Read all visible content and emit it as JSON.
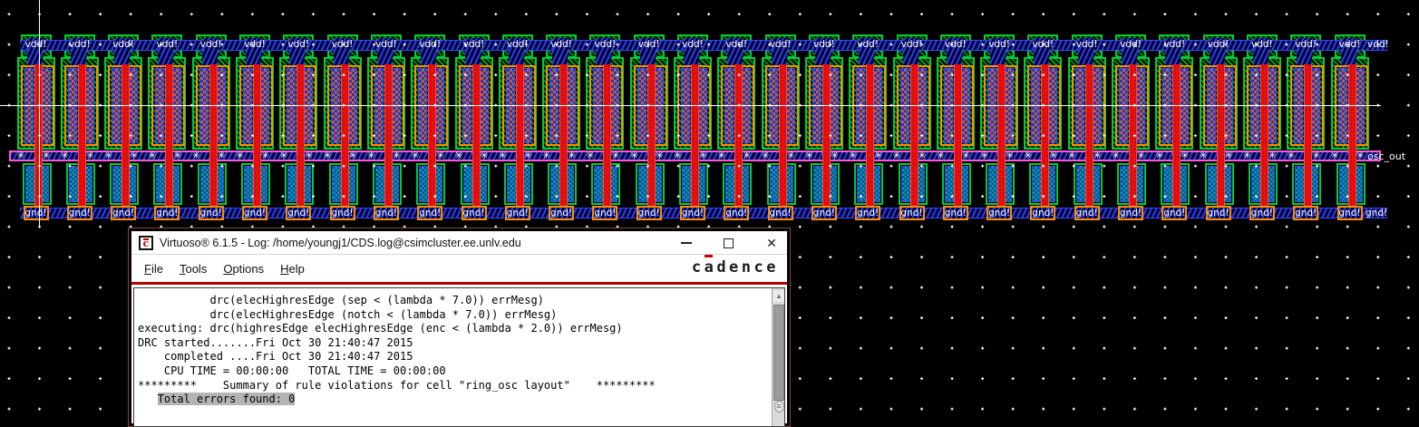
{
  "layout": {
    "cell_count": 31,
    "vdd_label": "vdd!",
    "gnd_label": "gnd!",
    "end_labels": {
      "vdd": "vdd!",
      "gnd": "gnd!",
      "output": "osc_out"
    },
    "colors": {
      "canvas": "#000000",
      "nwell_green": "#00cc33",
      "metal_blue": "#2a3cf0",
      "poly_red": "#e81010",
      "select_orange": "#ff8c00",
      "pin_pink": "#ff57d8",
      "contact_brown": "#c06030",
      "nmos_teal": "#00b070"
    }
  },
  "icons": {
    "pin_marker": "✳",
    "close": "✕",
    "scroll_up": "▲",
    "grip": "≡",
    "grid_dot": "+"
  },
  "window": {
    "title": "Virtuoso® 6.1.5 - Log: /home/youngj1/CDS.log@csimcluster.ee.unlv.edu",
    "brand": "cadence",
    "accent_red": "#b30000",
    "menu": [
      {
        "label": "File"
      },
      {
        "label": "Tools"
      },
      {
        "label": "Options"
      },
      {
        "label": "Help"
      }
    ],
    "log": {
      "lines": [
        {
          "text": "           drc(elecHighresEdge (sep < (lambda * 7.0)) errMesg)"
        },
        {
          "text": "           drc(elecHighresEdge (notch < (lambda * 7.0)) errMesg)"
        },
        {
          "text": "executing: drc(highresEdge elecHighresEdge (enc < (lambda * 2.0)) errMesg)"
        },
        {
          "text": "DRC started.......Fri Oct 30 21:40:47 2015"
        },
        {
          "text": "    completed ....Fri Oct 30 21:40:47 2015"
        },
        {
          "text": "    CPU TIME = 00:00:00   TOTAL TIME = 00:00:00"
        },
        {
          "text": "*********    Summary of rule violations for cell \"ring_osc layout\"    *********"
        },
        {
          "text": "   ",
          "highlight": "Total errors found: 0"
        }
      ]
    }
  }
}
